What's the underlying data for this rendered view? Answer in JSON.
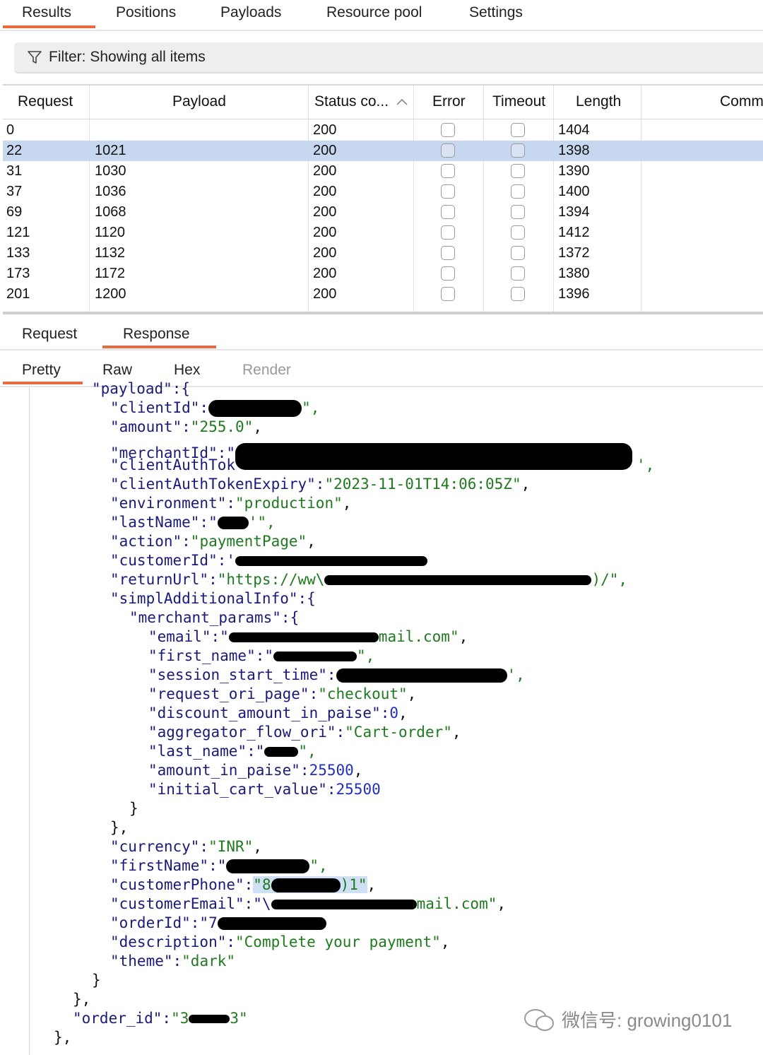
{
  "top_tabs": [
    "Results",
    "Positions",
    "Payloads",
    "Resource pool",
    "Settings"
  ],
  "filter": {
    "text": "Filter: Showing all items",
    "icon": "filter-icon"
  },
  "table": {
    "columns": [
      "Request",
      "Payload",
      "Status co...",
      "Error",
      "Timeout",
      "Length",
      "Comm"
    ],
    "rows": [
      {
        "request": "0",
        "payload": "",
        "status": "200",
        "length": "1404"
      },
      {
        "request": "22",
        "payload": "1021",
        "status": "200",
        "length": "1398"
      },
      {
        "request": "31",
        "payload": "1030",
        "status": "200",
        "length": "1390"
      },
      {
        "request": "37",
        "payload": "1036",
        "status": "200",
        "length": "1400"
      },
      {
        "request": "69",
        "payload": "1068",
        "status": "200",
        "length": "1394"
      },
      {
        "request": "121",
        "payload": "1120",
        "status": "200",
        "length": "1412"
      },
      {
        "request": "133",
        "payload": "1132",
        "status": "200",
        "length": "1372"
      },
      {
        "request": "173",
        "payload": "1172",
        "status": "200",
        "length": "1380"
      },
      {
        "request": "201",
        "payload": "1200",
        "status": "200",
        "length": "1396"
      }
    ],
    "selected_row": 1
  },
  "message_tabs": [
    "Request",
    "Response"
  ],
  "view_tabs": [
    "Pretty",
    "Raw",
    "Hex",
    "Render"
  ],
  "code": {
    "l0": "\"payload\":{",
    "l1a": "\"clientId\":",
    "l1b": "\",",
    "l2a": "\"amount\":",
    "l2b": "\"255.0\"",
    "l2c": ",",
    "l3a": "\"merchantId\":\"",
    "l4a": "\"clientAuthTok",
    "l4b": "',",
    "l5a": "\"clientAuthTokenExpiry\":",
    "l5b": "\"2023-11-01T14:06:05Z\"",
    "l5c": ",",
    "l6a": "\"environment\":",
    "l6b": "\"production\"",
    "l6c": ",",
    "l7a": "\"lastName\":\"",
    "l7b": "'\",",
    "l8a": "\"action\":",
    "l8b": "\"paymentPage\"",
    "l8c": ",",
    "l9a": "\"customerId\":'",
    "l10a": "\"returnUrl\":",
    "l10b": "\"https://ww\\",
    "l10c": ")/\",",
    "l11a": "\"simplAdditionalInfo\":{",
    "l12a": "\"merchant_params\":{",
    "l13a": "\"email\":\"",
    "l13b": "mail.com\"",
    "l13c": ",",
    "l14a": "\"first_name\":\"",
    "l14b": "\",",
    "l15a": "\"session_start_time\":",
    "l15b": "',",
    "l16a": "\"request_ori_page\":",
    "l16b": "\"checkout\"",
    "l16c": ",",
    "l17a": "\"discount_amount_in_paise\":",
    "l17b": "0",
    "l17c": ",",
    "l18a": "\"aggregator_flow_ori\":",
    "l18b": "\"Cart-order\"",
    "l18c": ",",
    "l19a": "\"last_name\":\"",
    "l19b": "\",",
    "l20a": "\"amount_in_paise\":",
    "l20b": "25500",
    "l20c": ",",
    "l21a": "\"initial_cart_value\":",
    "l21b": "25500",
    "l22": "}",
    "l23": "},",
    "l24a": "\"currency\":",
    "l24b": "\"INR\"",
    "l24c": ",",
    "l25a": "\"firstName\":\"",
    "l25b": "\",",
    "l26a": "\"customerPhone\":",
    "l26b": "\"8",
    "l26c": ")1\"",
    "l26d": ",",
    "l27a": "\"customerEmail\":\"\\",
    "l27b": "mail.com\"",
    "l27c": ",",
    "l28a": "\"orderId\":\"7",
    "l29a": "\"description\":",
    "l29b": "\"Complete your payment\"",
    "l29c": ",",
    "l30a": "\"theme\":",
    "l30b": "\"dark\"",
    "l31": "}",
    "l32": "},",
    "l33a": "\"order_id\":",
    "l33b": "\"3",
    "l33c": "3\"",
    "l34": "},"
  },
  "watermark": "微信号: growing0101",
  "colors": {
    "accent": "#ea6a3f",
    "selected_row": "#c8d7f0",
    "string": "#1f7a1f",
    "number": "#1f2fc0",
    "key": "#1a1a7a"
  }
}
